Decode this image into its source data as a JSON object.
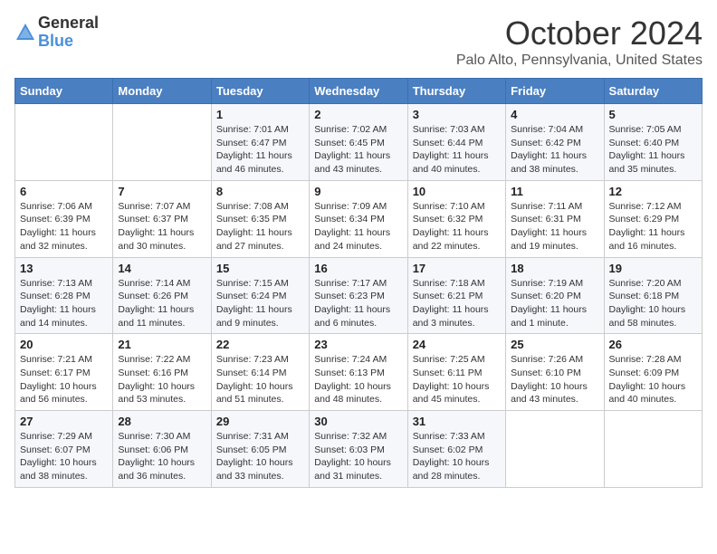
{
  "header": {
    "logo_general": "General",
    "logo_blue": "Blue",
    "month_title": "October 2024",
    "location": "Palo Alto, Pennsylvania, United States"
  },
  "days_of_week": [
    "Sunday",
    "Monday",
    "Tuesday",
    "Wednesday",
    "Thursday",
    "Friday",
    "Saturday"
  ],
  "weeks": [
    [
      {
        "day": "",
        "info": ""
      },
      {
        "day": "",
        "info": ""
      },
      {
        "day": "1",
        "info": "Sunrise: 7:01 AM\nSunset: 6:47 PM\nDaylight: 11 hours and 46 minutes."
      },
      {
        "day": "2",
        "info": "Sunrise: 7:02 AM\nSunset: 6:45 PM\nDaylight: 11 hours and 43 minutes."
      },
      {
        "day": "3",
        "info": "Sunrise: 7:03 AM\nSunset: 6:44 PM\nDaylight: 11 hours and 40 minutes."
      },
      {
        "day": "4",
        "info": "Sunrise: 7:04 AM\nSunset: 6:42 PM\nDaylight: 11 hours and 38 minutes."
      },
      {
        "day": "5",
        "info": "Sunrise: 7:05 AM\nSunset: 6:40 PM\nDaylight: 11 hours and 35 minutes."
      }
    ],
    [
      {
        "day": "6",
        "info": "Sunrise: 7:06 AM\nSunset: 6:39 PM\nDaylight: 11 hours and 32 minutes."
      },
      {
        "day": "7",
        "info": "Sunrise: 7:07 AM\nSunset: 6:37 PM\nDaylight: 11 hours and 30 minutes."
      },
      {
        "day": "8",
        "info": "Sunrise: 7:08 AM\nSunset: 6:35 PM\nDaylight: 11 hours and 27 minutes."
      },
      {
        "day": "9",
        "info": "Sunrise: 7:09 AM\nSunset: 6:34 PM\nDaylight: 11 hours and 24 minutes."
      },
      {
        "day": "10",
        "info": "Sunrise: 7:10 AM\nSunset: 6:32 PM\nDaylight: 11 hours and 22 minutes."
      },
      {
        "day": "11",
        "info": "Sunrise: 7:11 AM\nSunset: 6:31 PM\nDaylight: 11 hours and 19 minutes."
      },
      {
        "day": "12",
        "info": "Sunrise: 7:12 AM\nSunset: 6:29 PM\nDaylight: 11 hours and 16 minutes."
      }
    ],
    [
      {
        "day": "13",
        "info": "Sunrise: 7:13 AM\nSunset: 6:28 PM\nDaylight: 11 hours and 14 minutes."
      },
      {
        "day": "14",
        "info": "Sunrise: 7:14 AM\nSunset: 6:26 PM\nDaylight: 11 hours and 11 minutes."
      },
      {
        "day": "15",
        "info": "Sunrise: 7:15 AM\nSunset: 6:24 PM\nDaylight: 11 hours and 9 minutes."
      },
      {
        "day": "16",
        "info": "Sunrise: 7:17 AM\nSunset: 6:23 PM\nDaylight: 11 hours and 6 minutes."
      },
      {
        "day": "17",
        "info": "Sunrise: 7:18 AM\nSunset: 6:21 PM\nDaylight: 11 hours and 3 minutes."
      },
      {
        "day": "18",
        "info": "Sunrise: 7:19 AM\nSunset: 6:20 PM\nDaylight: 11 hours and 1 minute."
      },
      {
        "day": "19",
        "info": "Sunrise: 7:20 AM\nSunset: 6:18 PM\nDaylight: 10 hours and 58 minutes."
      }
    ],
    [
      {
        "day": "20",
        "info": "Sunrise: 7:21 AM\nSunset: 6:17 PM\nDaylight: 10 hours and 56 minutes."
      },
      {
        "day": "21",
        "info": "Sunrise: 7:22 AM\nSunset: 6:16 PM\nDaylight: 10 hours and 53 minutes."
      },
      {
        "day": "22",
        "info": "Sunrise: 7:23 AM\nSunset: 6:14 PM\nDaylight: 10 hours and 51 minutes."
      },
      {
        "day": "23",
        "info": "Sunrise: 7:24 AM\nSunset: 6:13 PM\nDaylight: 10 hours and 48 minutes."
      },
      {
        "day": "24",
        "info": "Sunrise: 7:25 AM\nSunset: 6:11 PM\nDaylight: 10 hours and 45 minutes."
      },
      {
        "day": "25",
        "info": "Sunrise: 7:26 AM\nSunset: 6:10 PM\nDaylight: 10 hours and 43 minutes."
      },
      {
        "day": "26",
        "info": "Sunrise: 7:28 AM\nSunset: 6:09 PM\nDaylight: 10 hours and 40 minutes."
      }
    ],
    [
      {
        "day": "27",
        "info": "Sunrise: 7:29 AM\nSunset: 6:07 PM\nDaylight: 10 hours and 38 minutes."
      },
      {
        "day": "28",
        "info": "Sunrise: 7:30 AM\nSunset: 6:06 PM\nDaylight: 10 hours and 36 minutes."
      },
      {
        "day": "29",
        "info": "Sunrise: 7:31 AM\nSunset: 6:05 PM\nDaylight: 10 hours and 33 minutes."
      },
      {
        "day": "30",
        "info": "Sunrise: 7:32 AM\nSunset: 6:03 PM\nDaylight: 10 hours and 31 minutes."
      },
      {
        "day": "31",
        "info": "Sunrise: 7:33 AM\nSunset: 6:02 PM\nDaylight: 10 hours and 28 minutes."
      },
      {
        "day": "",
        "info": ""
      },
      {
        "day": "",
        "info": ""
      }
    ]
  ]
}
